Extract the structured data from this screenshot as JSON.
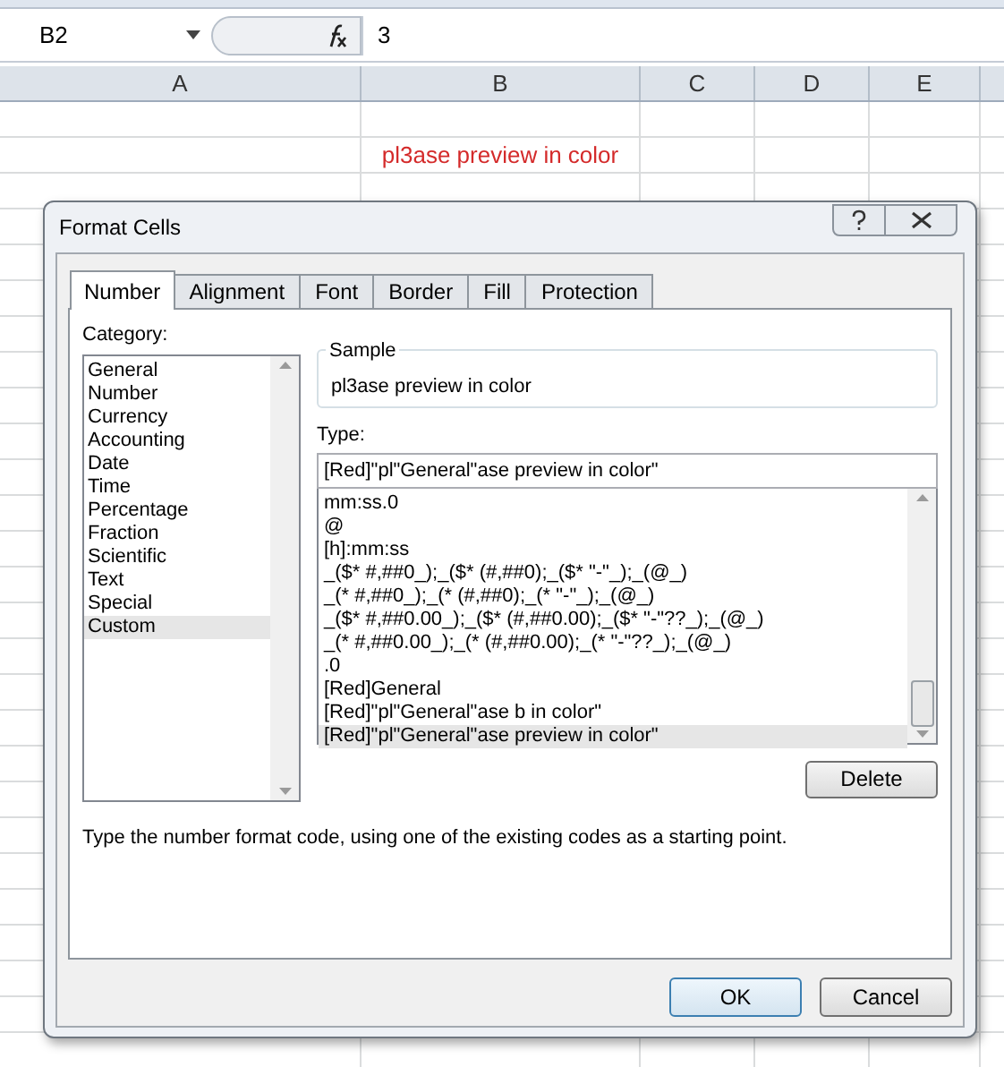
{
  "formula_bar": {
    "name_box": "B2",
    "formula": "3"
  },
  "columns": [
    "A",
    "B",
    "C",
    "D",
    "E"
  ],
  "cells": [
    {
      "text": "pl3ase preview in color",
      "color": "#d42a2a"
    }
  ],
  "dialog": {
    "title": "Format Cells",
    "tabs": [
      {
        "label": "Number",
        "selected": true
      },
      {
        "label": "Alignment",
        "selected": false
      },
      {
        "label": "Font",
        "selected": false
      },
      {
        "label": "Border",
        "selected": false
      },
      {
        "label": "Fill",
        "selected": false
      },
      {
        "label": "Protection",
        "selected": false
      }
    ],
    "category_label": "Category:",
    "categories": [
      {
        "label": "General",
        "selected": false
      },
      {
        "label": "Number",
        "selected": false
      },
      {
        "label": "Currency",
        "selected": false
      },
      {
        "label": "Accounting",
        "selected": false
      },
      {
        "label": "Date",
        "selected": false
      },
      {
        "label": "Time",
        "selected": false
      },
      {
        "label": "Percentage",
        "selected": false
      },
      {
        "label": "Fraction",
        "selected": false
      },
      {
        "label": "Scientific",
        "selected": false
      },
      {
        "label": "Text",
        "selected": false
      },
      {
        "label": "Special",
        "selected": false
      },
      {
        "label": "Custom",
        "selected": true
      }
    ],
    "sample": {
      "label": "Sample",
      "text": "pl3ase preview in color"
    },
    "type_label": "Type:",
    "type_value": "[Red]\"pl\"General\"ase preview in color\"",
    "formats": [
      {
        "label": "mm:ss.0",
        "selected": false
      },
      {
        "label": "@",
        "selected": false
      },
      {
        "label": "[h]:mm:ss",
        "selected": false
      },
      {
        "label": "_($* #,##0_);_($* (#,##0);_($* \"-\"_);_(@_)",
        "selected": false
      },
      {
        "label": "_(* #,##0_);_(* (#,##0);_(* \"-\"_);_(@_)",
        "selected": false
      },
      {
        "label": "_($* #,##0.00_);_($* (#,##0.00);_($* \"-\"??_);_(@_)",
        "selected": false
      },
      {
        "label": "_(* #,##0.00_);_(* (#,##0.00);_(* \"-\"??_);_(@_)",
        "selected": false
      },
      {
        "label": ".0",
        "selected": false
      },
      {
        "label": "[Red]General",
        "selected": false
      },
      {
        "label": "[Red]\"pl\"General\"ase b in color\"",
        "selected": false
      },
      {
        "label": "[Red]\"pl\"General\"ase preview in color\"",
        "selected": true
      }
    ],
    "delete_button": "Delete",
    "description": "Type the number format code, using one of the existing codes as a starting point.",
    "ok_button": "OK",
    "cancel_button": "Cancel"
  }
}
